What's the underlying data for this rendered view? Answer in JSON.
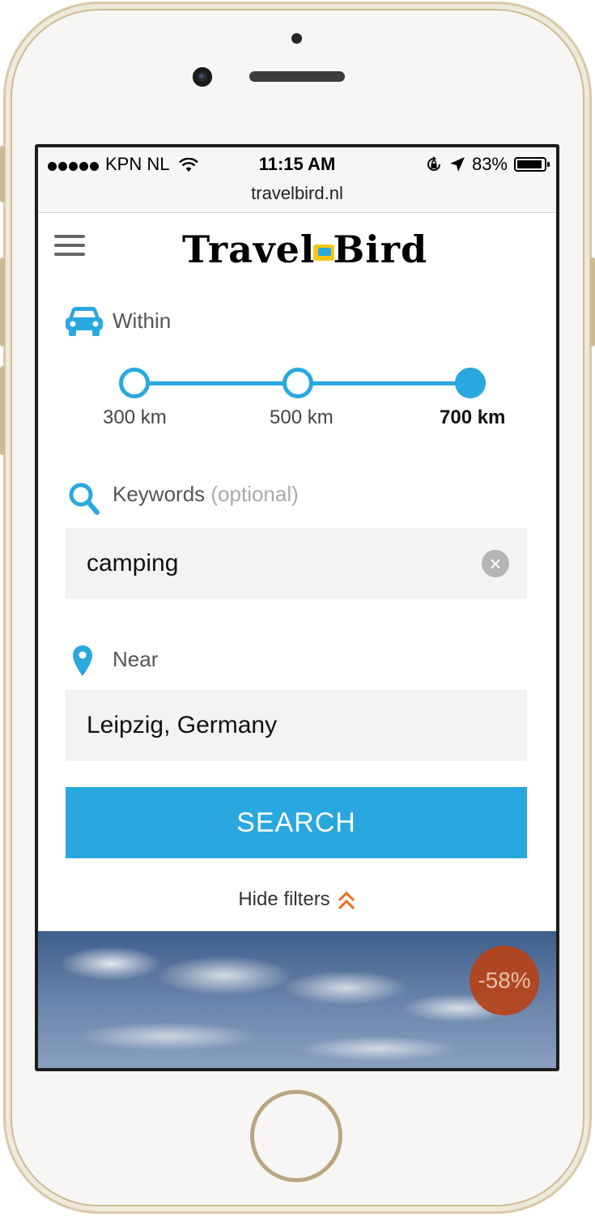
{
  "status_bar": {
    "carrier": "KPN NL",
    "time": "11:15 AM",
    "battery": "83%",
    "url": "travelbird.nl"
  },
  "header": {
    "logo_part1": "Travel",
    "logo_part2": "ird"
  },
  "within": {
    "label": "Within",
    "options": [
      "300 km",
      "500 km",
      "700 km"
    ],
    "selected": "700 km"
  },
  "keywords": {
    "label": "Keywords",
    "optional": "(optional)",
    "value": "camping",
    "clear_icon": "×"
  },
  "near": {
    "label": "Near",
    "value": "Leipzig, Germany"
  },
  "search_button": "SEARCH",
  "hide_filters": "Hide filters",
  "deal": {
    "discount": "-58%"
  },
  "colors": {
    "accent": "#29a8e0",
    "discount": "#b5451d",
    "chevron": "#f26b1d"
  }
}
